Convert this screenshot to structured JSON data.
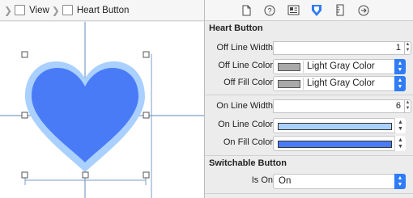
{
  "breadcrumb": {
    "items": [
      {
        "label": "View"
      },
      {
        "label": "Heart Button"
      }
    ]
  },
  "canvas": {
    "heart_fill": "#4a7bf7",
    "heart_outline": "#a9d0ff",
    "guide_color": "#7a9ec8"
  },
  "inspector": {
    "tabs": [
      "file-icon",
      "help-icon",
      "identity-icon",
      "attributes-icon",
      "size-icon",
      "connections-icon"
    ],
    "heart_section": {
      "title": "Heart Button",
      "off_line_width": {
        "label": "Off Line Width",
        "value": "1"
      },
      "off_line_color": {
        "label": "Off Line Color",
        "value": "Light Gray Color",
        "swatch": "#a9a9a9"
      },
      "off_fill_color": {
        "label": "Off Fill Color",
        "value": "Light Gray Color",
        "swatch": "#a9a9a9"
      },
      "on_line_width": {
        "label": "On Line Width",
        "value": "6"
      },
      "on_line_color": {
        "label": "On Line Color",
        "swatch": "#a9d0ff"
      },
      "on_fill_color": {
        "label": "On Fill Color",
        "swatch": "#4a7bf7"
      }
    },
    "switchable_section": {
      "title": "Switchable Button",
      "is_on": {
        "label": "Is On",
        "value": "On"
      }
    }
  },
  "colors": {
    "accent": "#2f7cf6"
  }
}
